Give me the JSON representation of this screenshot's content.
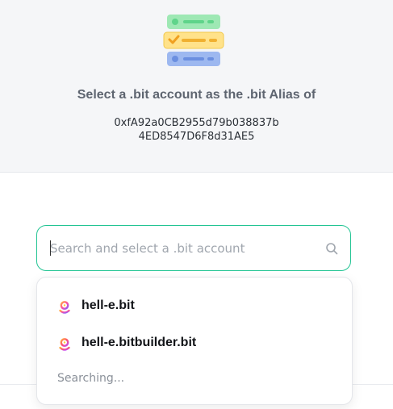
{
  "header": {
    "title": "Select a .bit account as the .bit Alias of",
    "address_line1": "0xfA92a0CB2955d79b038837b",
    "address_line2": "4ED8547D6F8d31AE5",
    "logo_icon": "stacked-list-icon"
  },
  "search": {
    "placeholder": "Search and select a .bit account",
    "value": "",
    "icon": "search-icon",
    "accent_color": "#22c493"
  },
  "dropdown": {
    "items": [
      {
        "label": "hell-e.bit",
        "icon": "bit-avatar-icon"
      },
      {
        "label": "hell-e.bitbuilder.bit",
        "icon": "bit-avatar-icon"
      }
    ],
    "status_text": "Searching..."
  }
}
